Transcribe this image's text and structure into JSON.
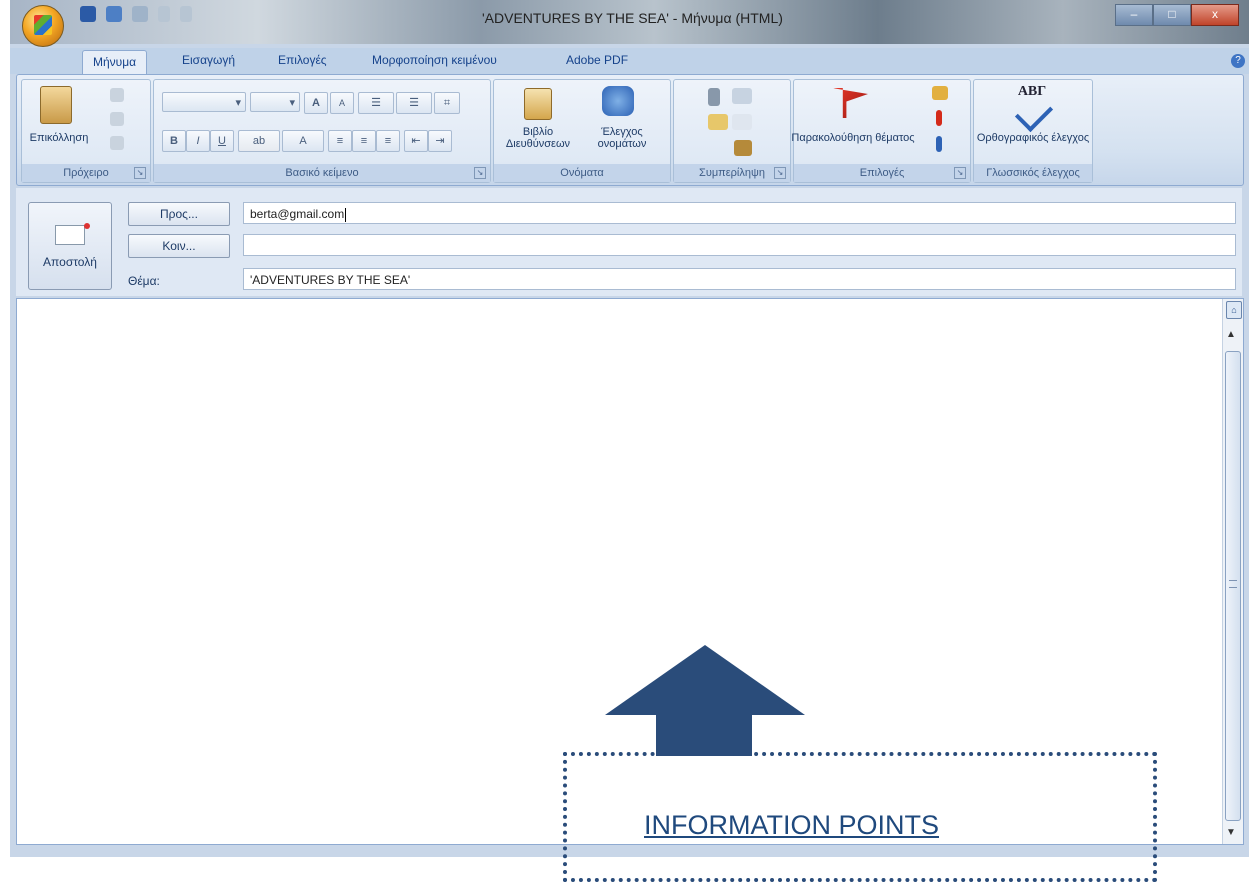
{
  "window": {
    "title": "'ADVENTURES BY THE SEA' - Μήνυμα (HTML)",
    "controls": {
      "minimize": "–",
      "maximize": "□",
      "close": "x"
    }
  },
  "tabs": [
    "Μήνυμα",
    "Εισαγωγή",
    "Επιλογές",
    "Μορφοποίηση κειμένου",
    "Adobe PDF"
  ],
  "ribbon": {
    "groups": {
      "clipboard": "Πρόχειρο",
      "basic_text": "Βασικό κείμενο",
      "names": "Ονόματα",
      "include": "Συμπερίληψη",
      "options": "Επιλογές",
      "proofing": "Γλωσσικός έλεγχος"
    },
    "paste_label": "Επικόλληση",
    "address_book_label": "Βιβλίο Διευθύνσεων",
    "check_names_label": "Έλεγχος ονομάτων",
    "follow_up_label": "Παρακολούθηση θέματος",
    "spelling_label": "Ορθογραφικός έλεγχος",
    "spelling_icon_text": "ΑΒΓ",
    "bold": "B",
    "italic": "I",
    "underline": "U",
    "grow_font": "A",
    "shrink_font": "A",
    "font_color": "A"
  },
  "header": {
    "send_label": "Αποστολή",
    "to_button": "Προς...",
    "cc_button": "Κοιν...",
    "subject_label": "Θέμα:",
    "to_value": "berta@gmail.com",
    "cc_value": "",
    "subject_value": "'ADVENTURES BY THE SEA'"
  },
  "overlay": {
    "label": "INFORMATION POINTS",
    "accent_color": "#2a4c7a"
  }
}
